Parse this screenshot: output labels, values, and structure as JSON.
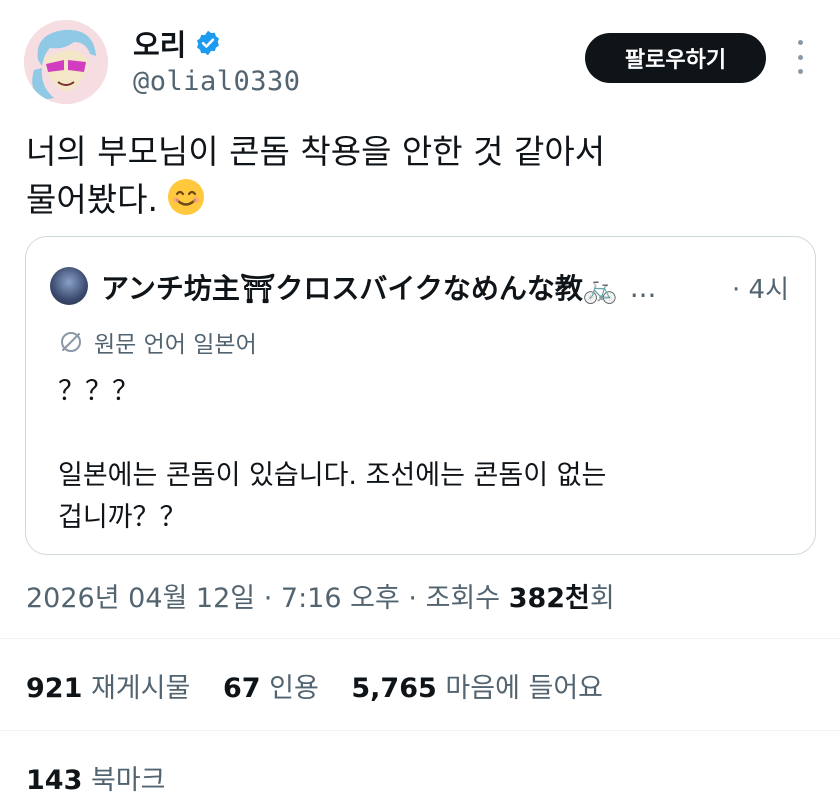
{
  "author": {
    "display_name": "오리",
    "handle": "@olial0330",
    "verified_icon": "verified-badge-icon",
    "verified_color": "#1d9bf0"
  },
  "follow_button": {
    "label": "팔로우하기"
  },
  "tweet": {
    "text_line1": "너의 부모님이 콘돔 착용을 안한 것 같아서",
    "text_line2": "물어봤다.",
    "emoji": "smiling-face-emoji"
  },
  "quoted_tweet": {
    "author_name": "アンチ坊主⛩クロスバイクなめんな教🚲",
    "ellipsis": "...",
    "time": "· 4시",
    "translate_label": "원문 언어 일본어",
    "body_line1": "？？？",
    "body_line2": "일본에는 콘돔이 있습니다. 조선에는 콘돔이 없는",
    "body_line3": "겁니까？？"
  },
  "meta": {
    "date": "2026년 04월 12일",
    "time": "7:16 오후",
    "views_label": "조회수",
    "views_count": "382천",
    "views_suffix": "회"
  },
  "stats": {
    "retweets_count": "921",
    "retweets_label": "재게시물",
    "quotes_count": "67",
    "quotes_label": "인용",
    "likes_count": "5,765",
    "likes_label": "마음에 들어요",
    "bookmarks_count": "143",
    "bookmarks_label": "북마크"
  },
  "colors": {
    "text_primary": "#0f1419",
    "text_secondary": "#536471",
    "border": "#cfd9de",
    "button_bg": "#0f1419"
  }
}
